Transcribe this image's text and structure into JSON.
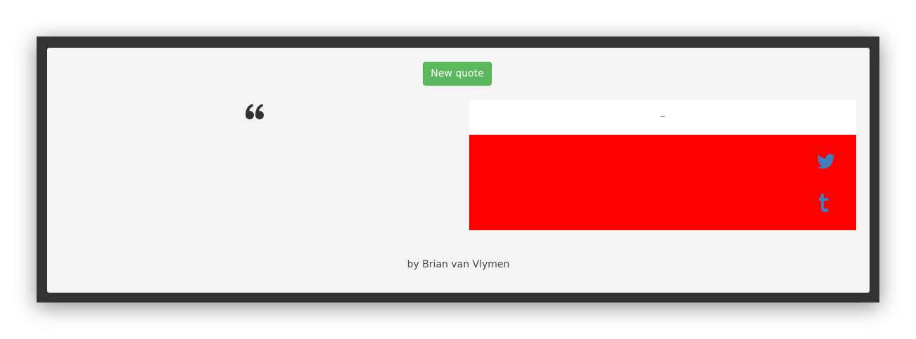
{
  "toolbar": {
    "new_quote_label": "New quote"
  },
  "quote": {
    "text": "",
    "author": "–"
  },
  "share": {
    "twitter_icon": "twitter-icon",
    "tumblr_icon": "tumblr-icon"
  },
  "footer": {
    "credit": "by Brian van Vlymen"
  },
  "colors": {
    "frame": "#333333",
    "card": "#f4f4f4",
    "button": "#5cb85c",
    "share_panel": "#ff0000",
    "icon": "#3f7fbf"
  }
}
